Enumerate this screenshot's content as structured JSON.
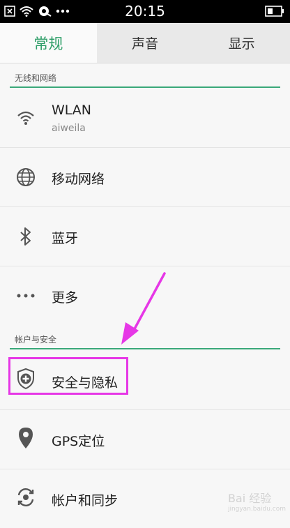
{
  "status_bar": {
    "time": "20:15",
    "icons": [
      "close-box-icon",
      "wifi-icon",
      "notification-icon",
      "more-dots-icon",
      "battery-icon"
    ]
  },
  "tabs": [
    {
      "label": "常规",
      "active": true
    },
    {
      "label": "声音",
      "active": false
    },
    {
      "label": "显示",
      "active": false
    }
  ],
  "sections": {
    "wireless": {
      "header": "无线和网络"
    },
    "account": {
      "header": "帐户与安全"
    }
  },
  "rows": {
    "wlan": {
      "title": "WLAN",
      "subtitle": "aiweila",
      "icon": "wifi-icon"
    },
    "mobile": {
      "title": "移动网络",
      "icon": "globe-icon"
    },
    "bluetooth": {
      "title": "蓝牙",
      "icon": "bluetooth-icon"
    },
    "more": {
      "title": "更多",
      "icon": "ellipsis-icon"
    },
    "security": {
      "title": "安全与隐私",
      "icon": "shield-plus-icon"
    },
    "gps": {
      "title": "GPS定位",
      "icon": "location-pin-icon"
    },
    "sync": {
      "title": "帐户和同步",
      "icon": "sync-icon"
    }
  },
  "annotation": {
    "color": "#e637e6"
  },
  "watermark": {
    "text": "Bai 经验",
    "url": "jingyan.baidu.com"
  },
  "colors": {
    "accent": "#2e9e68",
    "rule": "#3aa879"
  }
}
